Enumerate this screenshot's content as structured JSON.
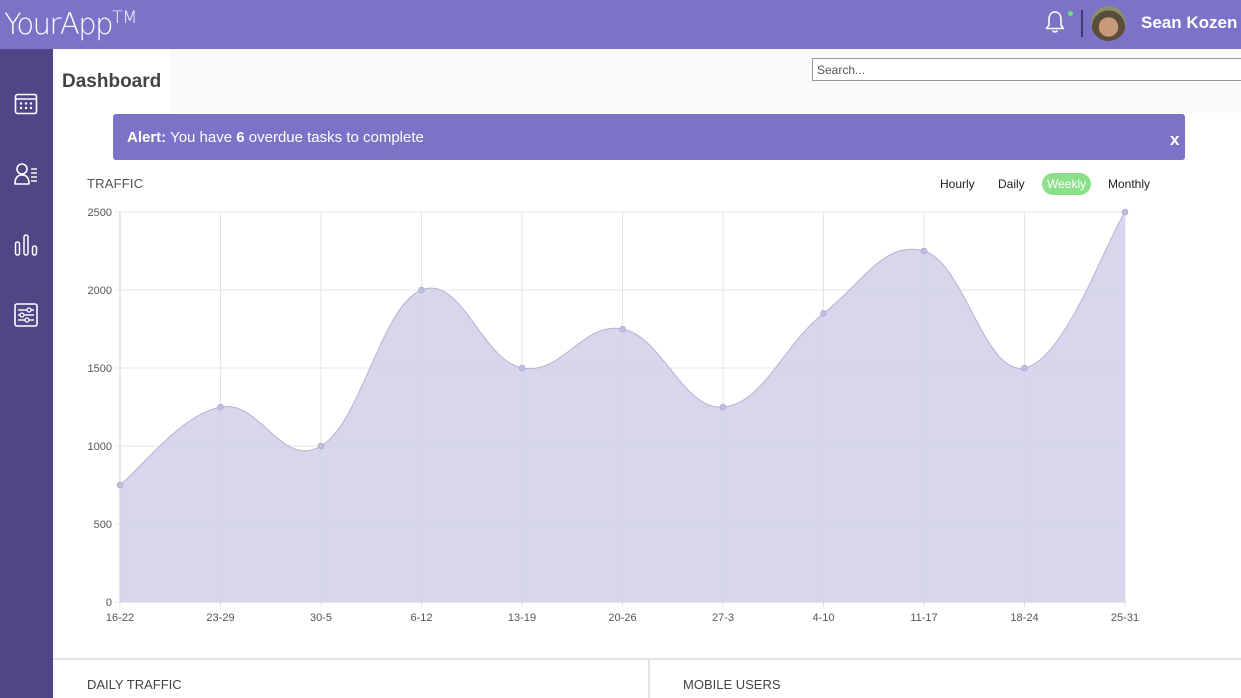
{
  "header": {
    "logo_your": "Your",
    "logo_app": "App",
    "logo_tm": "TM",
    "user_name": "Sean Kozen",
    "icons": {
      "bell": "bell-icon",
      "avatar": "user-avatar"
    }
  },
  "sidebar": {
    "items": [
      {
        "icon": "calendar-icon"
      },
      {
        "icon": "user-list-icon"
      },
      {
        "icon": "bar-chart-icon"
      },
      {
        "icon": "sliders-icon"
      }
    ]
  },
  "page": {
    "title": "Dashboard",
    "search_placeholder": "Search..."
  },
  "alert": {
    "label": "Alert:",
    "text_before": " You have ",
    "count": "6",
    "text_after": " overdue tasks to complete",
    "close": "x"
  },
  "traffic": {
    "title": "TRAFFIC",
    "tabs": [
      "Hourly",
      "Daily",
      "Weekly",
      "Monthly"
    ],
    "active_tab": "Weekly"
  },
  "chart_data": {
    "type": "area",
    "categories": [
      "16-22",
      "23-29",
      "30-5",
      "6-12",
      "13-19",
      "20-26",
      "27-3",
      "4-10",
      "11-17",
      "18-24",
      "25-31"
    ],
    "values": [
      750,
      1250,
      1000,
      2000,
      1500,
      1750,
      1250,
      1850,
      2250,
      1500,
      2500
    ],
    "ylim": [
      0,
      2500
    ],
    "yticks": [
      0,
      500,
      1000,
      1500,
      2000,
      2500
    ],
    "grid": true,
    "fill_color": "#d5d4ea",
    "line_color": "#b5b3d6"
  },
  "bottom_panels": {
    "daily_traffic": "DAILY TRAFFIC",
    "mobile_users": "MOBILE USERS"
  },
  "colors": {
    "header": "#7c72c8",
    "sidebar": "#4f4686",
    "active_tab": "#8ce08a"
  }
}
